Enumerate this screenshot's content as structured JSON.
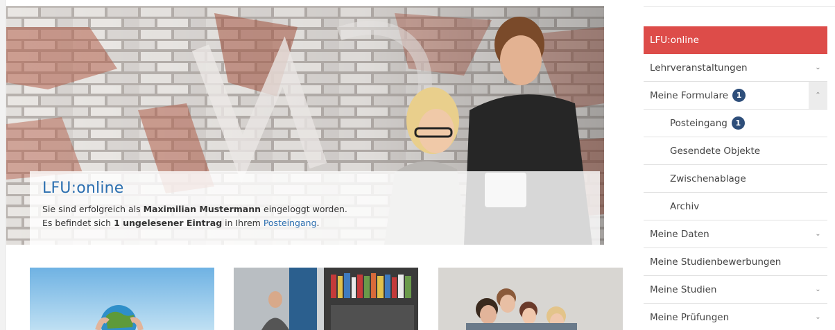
{
  "hero": {
    "title": "LFU:online",
    "line1_prefix": "Sie sind erfolgreich als ",
    "line1_name": "Maximilian Mustermann",
    "line1_suffix": " eingeloggt worden.",
    "line2_prefix": "Es befindet sich ",
    "line2_bold": "1 ungelesener Eintrag",
    "line2_mid": " in Ihrem ",
    "line2_link": "Posteingang",
    "line2_end": "."
  },
  "sidebar": {
    "items": [
      {
        "label": "LFU:online",
        "active": true
      },
      {
        "label": "Lehrveranstaltungen",
        "chevron": "⌄"
      },
      {
        "label": "Meine Formulare",
        "badge": "1",
        "chevron": "⌃"
      },
      {
        "label": "Posteingang",
        "badge": "1"
      },
      {
        "label": "Gesendete Objekte"
      },
      {
        "label": "Zwischenablage"
      },
      {
        "label": "Archiv"
      },
      {
        "label": "Meine Daten",
        "chevron": "⌄"
      },
      {
        "label": "Meine Studienbewerbungen"
      },
      {
        "label": "Meine Studien",
        "chevron": "⌄"
      },
      {
        "label": "Meine Prüfungen",
        "chevron": "⌄"
      }
    ]
  },
  "colors": {
    "accent_red": "#dd4c49",
    "link_blue": "#2c6fb0",
    "badge_navy": "#2e4e7a"
  },
  "icons": {
    "chevron_down": "chevron-down-icon",
    "chevron_up": "chevron-up-icon"
  }
}
